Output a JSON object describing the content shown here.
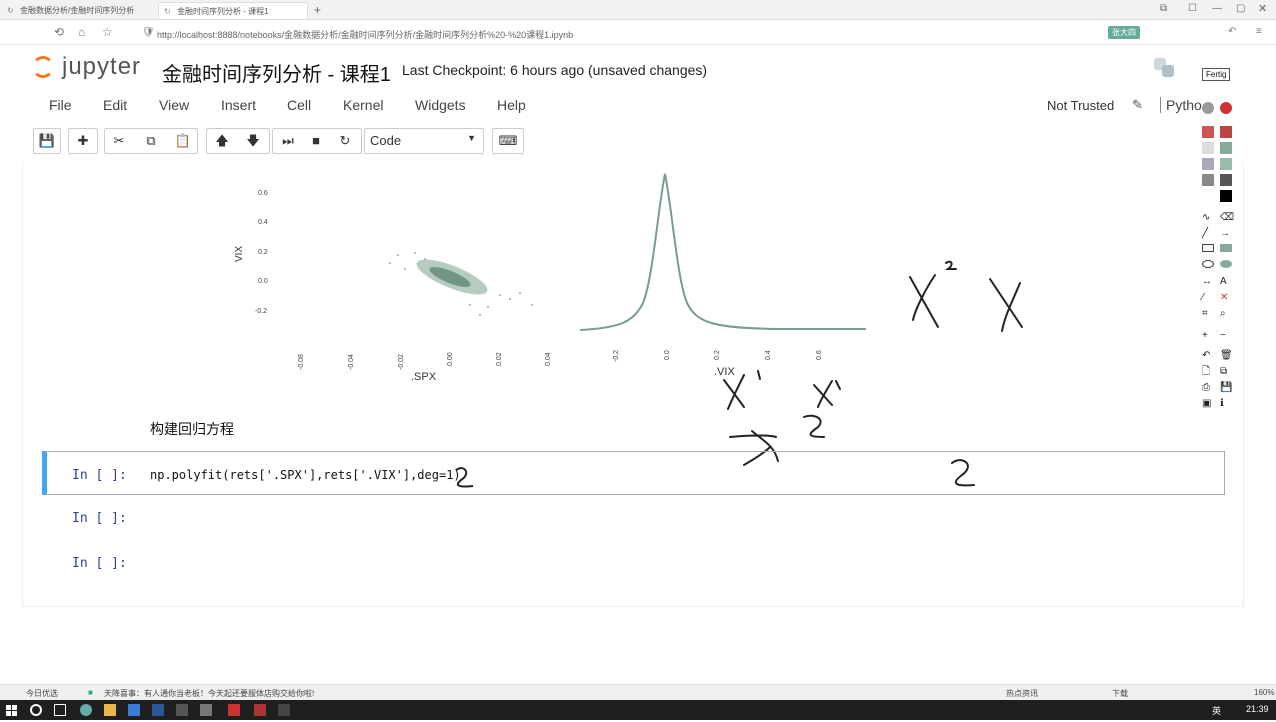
{
  "browser": {
    "tabs": [
      {
        "label": "金融数据分析/金融时间序列分析"
      },
      {
        "label": "金融时间序列分析 - 课程1"
      }
    ],
    "url": "http://localhost:8888/notebooks/金融数据分析/金融时间序列分析/金融时间序列分析%20-%20课程1.ipynb",
    "badge": "张大四"
  },
  "jupyter": {
    "logo": "jupyter",
    "title": "金融时间序列分析 - 课程1",
    "checkpoint": "Last Checkpoint: 6 hours ago (unsaved changes)",
    "menu": [
      "File",
      "Edit",
      "View",
      "Insert",
      "Cell",
      "Kernel",
      "Widgets",
      "Help"
    ],
    "trust": "Not Trusted",
    "kernel": "Pytho",
    "cell_type": "Code"
  },
  "toolbar_icons": [
    "save-icon",
    "add-icon",
    "cut-icon",
    "copy-icon",
    "paste-icon",
    "move-up-icon",
    "move-down-icon",
    "run-icon",
    "stop-icon",
    "restart-icon",
    "keyboard-icon"
  ],
  "plot": {
    "scatter": {
      "ylabel": "VIX",
      "xlabel": ".SPX",
      "yticks": [
        "0.6",
        "0.4",
        "0.2",
        "0.0",
        "-0.2"
      ],
      "xticks": [
        "-0.08",
        "-0.04",
        "-0.02",
        "0.00",
        "0.02",
        "0.04"
      ]
    },
    "density": {
      "xlabel": ".VIX",
      "xticks": [
        "-0.2",
        "0.0",
        "0.2",
        "0.4",
        "0.6"
      ]
    }
  },
  "markdown": {
    "text": "构建回归方程"
  },
  "cells": [
    {
      "prompt": "In [ ]:",
      "code": "np.polyfit(rets['.SPX'],rets['.VIX'],deg=1)"
    },
    {
      "prompt": "In [ ]:",
      "code": ""
    },
    {
      "prompt": "In [ ]:",
      "code": ""
    }
  ],
  "annotation": {
    "done_label": "Fertig"
  },
  "statusbar": {
    "left": "今日优选",
    "news": "天降喜事：有人通你当老板！今天起还要服体店购交给你啦!",
    "right": "热点资讯",
    "download": "下载",
    "zoom": "160%"
  },
  "taskbar": {
    "ime": "英",
    "time": "21:39"
  }
}
